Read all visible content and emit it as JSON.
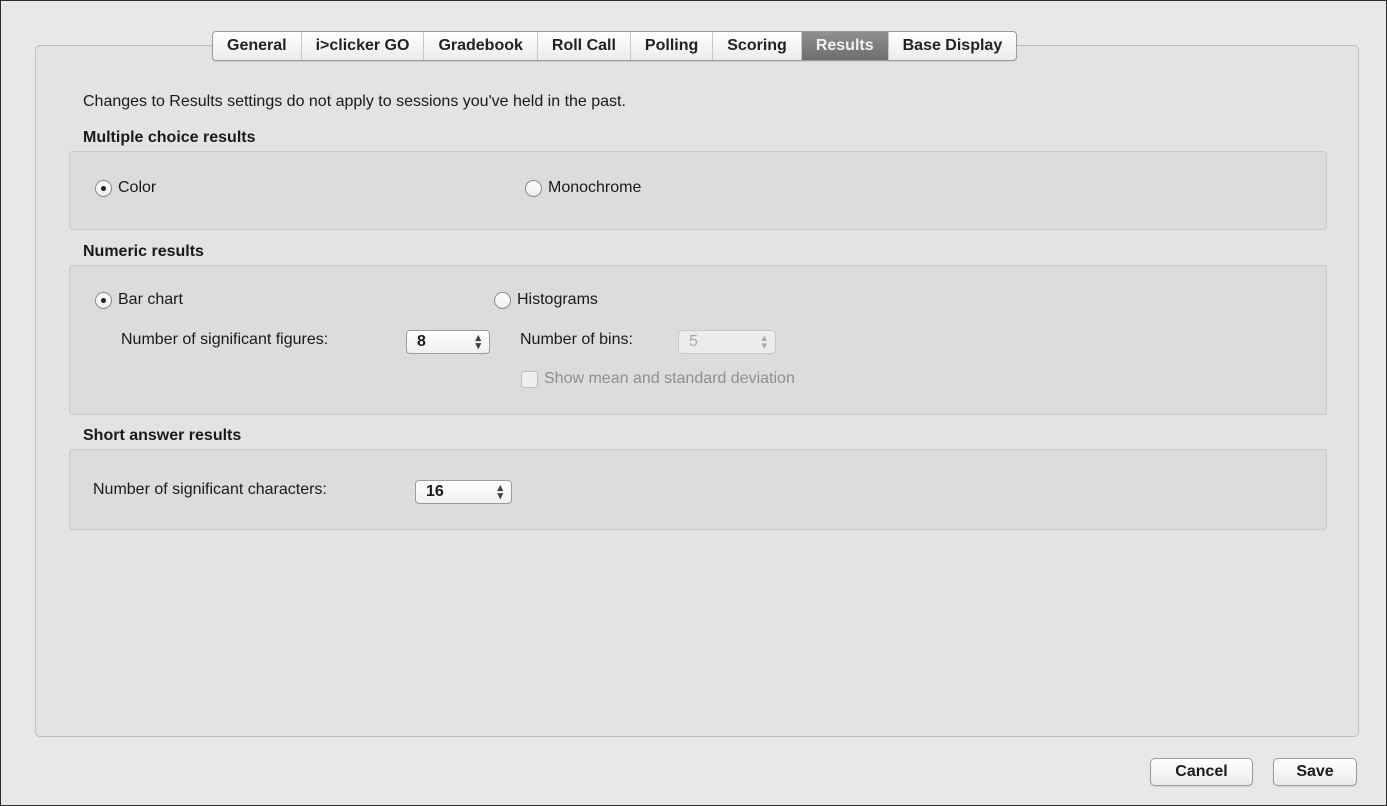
{
  "tabs": [
    {
      "label": "General",
      "active": false
    },
    {
      "label": "i>clicker GO",
      "active": false
    },
    {
      "label": "Gradebook",
      "active": false
    },
    {
      "label": "Roll Call",
      "active": false
    },
    {
      "label": "Polling",
      "active": false
    },
    {
      "label": "Scoring",
      "active": false
    },
    {
      "label": "Results",
      "active": true
    },
    {
      "label": "Base Display",
      "active": false
    }
  ],
  "intro_text": "Changes to Results settings do not apply to sessions you've held in the past.",
  "multiple_choice": {
    "title": "Multiple choice results",
    "options": [
      {
        "label": "Color",
        "selected": true
      },
      {
        "label": "Monochrome",
        "selected": false
      }
    ]
  },
  "numeric": {
    "title": "Numeric results",
    "bar_chart_label": "Bar chart",
    "bar_chart_selected": true,
    "histograms_label": "Histograms",
    "histograms_selected": false,
    "sig_figures_label": "Number of significant figures:",
    "sig_figures_value": "8",
    "bins_label": "Number of bins:",
    "bins_value": "5",
    "bins_enabled": false,
    "show_mean_label": "Show mean and standard deviation",
    "show_mean_checked": false,
    "show_mean_enabled": false
  },
  "short_answer": {
    "title": "Short answer results",
    "sig_chars_label": "Number of significant characters:",
    "sig_chars_value": "16"
  },
  "buttons": {
    "cancel": "Cancel",
    "save": "Save"
  },
  "colors": {
    "active_tab": "#7c7c7c",
    "panel": "#e3e3e3",
    "group": "#dcdcdc"
  }
}
